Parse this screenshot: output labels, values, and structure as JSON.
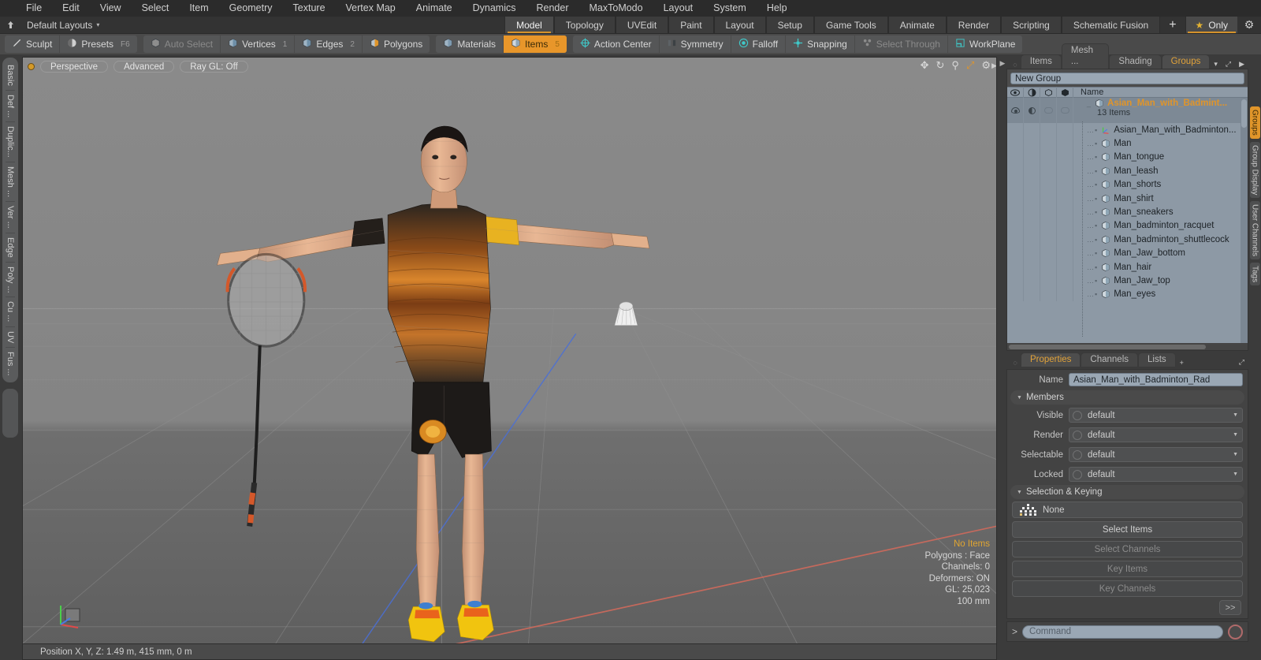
{
  "menubar": {
    "items": [
      "File",
      "Edit",
      "View",
      "Select",
      "Item",
      "Geometry",
      "Texture",
      "Vertex Map",
      "Animate",
      "Dynamics",
      "Render",
      "MaxToModo",
      "Layout",
      "System",
      "Help"
    ]
  },
  "layoutbar": {
    "pin_icon": "pin-icon",
    "default_layouts": "Default Layouts",
    "caret": "▾",
    "tabs": [
      {
        "label": "Model",
        "active": true
      },
      {
        "label": "Topology",
        "active": false
      },
      {
        "label": "UVEdit",
        "active": false
      },
      {
        "label": "Paint",
        "active": false
      },
      {
        "label": "Layout",
        "active": false
      },
      {
        "label": "Setup",
        "active": false
      },
      {
        "label": "Game Tools",
        "active": false
      },
      {
        "label": "Animate",
        "active": false
      },
      {
        "label": "Render",
        "active": false
      },
      {
        "label": "Scripting",
        "active": false
      },
      {
        "label": "Schematic Fusion",
        "active": false
      }
    ],
    "add_tab": "+",
    "only_label": "Only",
    "star_icon": "★",
    "gear_icon": "gear-icon"
  },
  "modebar": {
    "group1": [
      {
        "label": "Sculpt",
        "icon": "pencil-icon",
        "state": "normal",
        "num": ""
      },
      {
        "label": "Presets",
        "icon": "sphere-icon",
        "state": "normal",
        "num": "F6"
      }
    ],
    "group2": [
      {
        "label": "Auto Select",
        "icon": "cube-grey-icon",
        "state": "dim",
        "num": ""
      },
      {
        "label": "Vertices",
        "icon": "cube-vertex-icon",
        "state": "normal",
        "num": "1"
      },
      {
        "label": "Edges",
        "icon": "cube-edge-icon",
        "state": "normal",
        "num": "2"
      },
      {
        "label": "Polygons",
        "icon": "cube-poly-icon",
        "state": "normal",
        "num": ""
      }
    ],
    "group3": [
      {
        "label": "Materials",
        "icon": "cube-material-icon",
        "state": "normal",
        "num": ""
      },
      {
        "label": "Items",
        "icon": "cube-items-icon",
        "state": "selected",
        "num": "5"
      }
    ],
    "group4": [
      {
        "label": "Action Center",
        "icon": "target-icon",
        "state": "normal",
        "num": ""
      },
      {
        "label": "Symmetry",
        "icon": "symmetry-icon",
        "state": "normal",
        "num": ""
      },
      {
        "label": "Falloff",
        "icon": "falloff-icon",
        "state": "normal",
        "num": ""
      },
      {
        "label": "Snapping",
        "icon": "snap-icon",
        "state": "normal",
        "num": ""
      },
      {
        "label": "Select Through",
        "icon": "select-through-icon",
        "state": "dim",
        "num": ""
      },
      {
        "label": "WorkPlane",
        "icon": "workplane-icon",
        "state": "normal",
        "num": ""
      }
    ]
  },
  "left_toolstrip": {
    "items": [
      "Basic",
      "Def ...",
      "Duplic...",
      "Mesh ...",
      "Ver ...",
      "Edge",
      "Poly ...",
      "Cu ...",
      "UV",
      "Fus ..."
    ]
  },
  "viewport": {
    "dot_icon": "viewport-active-dot",
    "pills": [
      "Perspective",
      "Advanced",
      "Ray GL: Off"
    ],
    "icons": [
      "move-icon",
      "rotate-icon",
      "zoom-magnifier-icon",
      "fit-expand-icon",
      "gear-icon"
    ],
    "collapse_arrow": "▶",
    "stats": [
      {
        "text": "No Items",
        "highlight": true
      },
      {
        "text": "Polygons : Face",
        "highlight": false
      },
      {
        "text": "Channels: 0",
        "highlight": false
      },
      {
        "text": "Deformers: ON",
        "highlight": false
      },
      {
        "text": "GL: 25,023",
        "highlight": false
      },
      {
        "text": "100 mm",
        "highlight": false
      }
    ],
    "axis_gizmo": "axis-gizmo-icon"
  },
  "statusline": {
    "text": "Position X, Y, Z:   1.49 m, 415 mm, 0 m"
  },
  "right_panel": {
    "handle_icon": "panel-collapse-icon",
    "tabs": [
      {
        "label": "Items",
        "active": false
      },
      {
        "label": "Mesh ...",
        "active": false
      },
      {
        "label": "Shading",
        "active": false
      },
      {
        "label": "Groups",
        "active": true
      }
    ],
    "tab_caret": "▾",
    "tab_expand_icon": "expand-icon",
    "tab_arrow_icon": "▶",
    "new_group_button": "New Group",
    "list_columns": [
      "visibility-eye-column",
      "shading-column",
      "wireframe-column",
      "selection-column",
      "Name"
    ],
    "group": {
      "name": "Asian_Man_with_Badmint...",
      "count_label": "13 Items",
      "icon": "group-cube-icon"
    },
    "items": [
      {
        "name": "Asian_Man_with_Badminton...",
        "icon": "locator-axis-icon"
      },
      {
        "name": "Man",
        "icon": "mesh-cube-icon"
      },
      {
        "name": "Man_tongue",
        "icon": "mesh-cube-icon"
      },
      {
        "name": "Man_leash",
        "icon": "mesh-cube-icon"
      },
      {
        "name": "Man_shorts",
        "icon": "mesh-cube-icon"
      },
      {
        "name": "Man_shirt",
        "icon": "mesh-cube-icon"
      },
      {
        "name": "Man_sneakers",
        "icon": "mesh-cube-icon"
      },
      {
        "name": "Man_badminton_racquet",
        "icon": "mesh-cube-icon"
      },
      {
        "name": "Man_badminton_shuttlecock",
        "icon": "mesh-cube-icon"
      },
      {
        "name": "Man_Jaw_bottom",
        "icon": "mesh-cube-icon"
      },
      {
        "name": "Man_hair",
        "icon": "mesh-cube-icon"
      },
      {
        "name": "Man_Jaw_top",
        "icon": "mesh-cube-icon"
      },
      {
        "name": "Man_eyes",
        "icon": "mesh-cube-icon"
      }
    ],
    "side_tabs": [
      {
        "label": "Groups",
        "accent": true
      },
      {
        "label": "Group Display",
        "accent": false
      },
      {
        "label": "User Channels",
        "accent": false
      },
      {
        "label": "Tags",
        "accent": false
      }
    ]
  },
  "properties": {
    "tabs": [
      {
        "label": "Properties",
        "active": true
      },
      {
        "label": "Channels",
        "active": false
      },
      {
        "label": "Lists",
        "active": false
      }
    ],
    "add_tab": "+",
    "expand_icon": "expand-icon",
    "name_label": "Name",
    "name_value": "Asian_Man_with_Badminton_Rad",
    "members_section": "Members",
    "fields": [
      {
        "label": "Visible",
        "value": "default"
      },
      {
        "label": "Render",
        "value": "default"
      },
      {
        "label": "Selectable",
        "value": "default"
      },
      {
        "label": "Locked",
        "value": "default"
      }
    ],
    "selection_section": "Selection & Keying",
    "buttons": [
      {
        "label": "None",
        "dim": false,
        "icon": "key-grid-icon"
      },
      {
        "label": "Select Items",
        "dim": false,
        "icon": ""
      },
      {
        "label": "Select Channels",
        "dim": true,
        "icon": ""
      },
      {
        "label": "Key Items",
        "dim": true,
        "icon": ""
      },
      {
        "label": "Key Channels",
        "dim": true,
        "icon": ""
      }
    ],
    "forward_button": ">>"
  },
  "command_bar": {
    "prompt": ">",
    "placeholder": "Command",
    "record_button": "record-icon"
  },
  "colors": {
    "accent_orange": "#e0952a",
    "panel_blue_grey": "#8d99a5",
    "window_bg": "#3b3b3b",
    "viewport_bg": "#7b7b7b"
  }
}
